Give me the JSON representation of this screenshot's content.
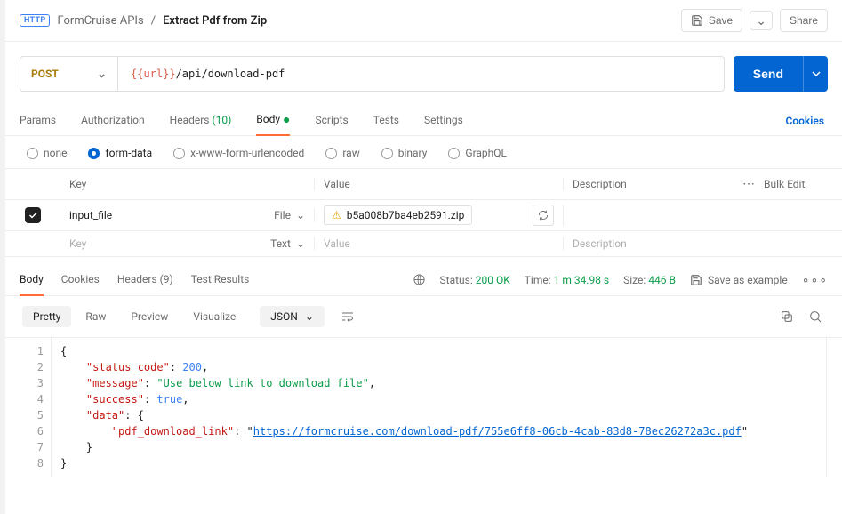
{
  "breadcrumb": {
    "collection": "FormCruise APIs",
    "request_name": "Extract Pdf from Zip"
  },
  "toolbar": {
    "save_label": "Save",
    "share_label": "Share"
  },
  "request": {
    "method": "POST",
    "url_variable": "{{url}}",
    "url_path": "/api/download-pdf",
    "send_label": "Send"
  },
  "request_tabs": {
    "params": "Params",
    "authorization": "Authorization",
    "headers_label": "Headers",
    "headers_count": "(10)",
    "body": "Body",
    "scripts": "Scripts",
    "tests": "Tests",
    "settings": "Settings",
    "cookies": "Cookies"
  },
  "body_types": {
    "none": "none",
    "form_data": "form-data",
    "x_www": "x-www-form-urlencoded",
    "raw": "raw",
    "binary": "binary",
    "graphql": "GraphQL"
  },
  "formdata_table": {
    "header_key": "Key",
    "header_value": "Value",
    "header_desc": "Description",
    "bulk_edit": "Bulk Edit",
    "rows": [
      {
        "key": "input_file",
        "type": "File",
        "file_name": "b5a008b7ba4eb2591.zip",
        "description": ""
      }
    ],
    "placeholder": {
      "key": "Key",
      "type": "Text",
      "value": "Value",
      "description": "Description"
    }
  },
  "response": {
    "tabs": {
      "body": "Body",
      "cookies": "Cookies",
      "headers_label": "Headers",
      "headers_count": "(9)",
      "test_results": "Test Results"
    },
    "meta": {
      "status_label": "Status:",
      "status_value": "200 OK",
      "time_label": "Time:",
      "time_value": "1 m 34.98 s",
      "size_label": "Size:",
      "size_value": "446 B",
      "save_example": "Save as example"
    },
    "view": {
      "pretty": "Pretty",
      "raw": "Raw",
      "preview": "Preview",
      "visualize": "Visualize",
      "fmt": "JSON"
    },
    "json_lines": [
      {
        "parts": [
          {
            "t": "punct",
            "v": "{"
          }
        ]
      },
      {
        "parts": [
          {
            "t": "ind",
            "v": "    "
          },
          {
            "t": "key",
            "v": "\"status_code\""
          },
          {
            "t": "punct",
            "v": ": "
          },
          {
            "t": "num",
            "v": "200"
          },
          {
            "t": "punct",
            "v": ","
          }
        ]
      },
      {
        "parts": [
          {
            "t": "ind",
            "v": "    "
          },
          {
            "t": "key",
            "v": "\"message\""
          },
          {
            "t": "punct",
            "v": ": "
          },
          {
            "t": "str",
            "v": "\"Use below link to download file\""
          },
          {
            "t": "punct",
            "v": ","
          }
        ]
      },
      {
        "parts": [
          {
            "t": "ind",
            "v": "    "
          },
          {
            "t": "key",
            "v": "\"success\""
          },
          {
            "t": "punct",
            "v": ": "
          },
          {
            "t": "num",
            "v": "true"
          },
          {
            "t": "punct",
            "v": ","
          }
        ]
      },
      {
        "parts": [
          {
            "t": "ind",
            "v": "    "
          },
          {
            "t": "key",
            "v": "\"data\""
          },
          {
            "t": "punct",
            "v": ": {"
          }
        ]
      },
      {
        "parts": [
          {
            "t": "ind",
            "v": "        "
          },
          {
            "t": "key",
            "v": "\"pdf_download_link\""
          },
          {
            "t": "punct",
            "v": ": \""
          },
          {
            "t": "link",
            "v": "https://formcruise.com/download-pdf/755e6ff8-06cb-4cab-83d8-78ec26272a3c.pdf"
          },
          {
            "t": "punct",
            "v": "\""
          }
        ]
      },
      {
        "parts": [
          {
            "t": "ind",
            "v": "    "
          },
          {
            "t": "punct",
            "v": "}"
          }
        ]
      },
      {
        "parts": [
          {
            "t": "punct",
            "v": "}"
          }
        ]
      }
    ]
  }
}
